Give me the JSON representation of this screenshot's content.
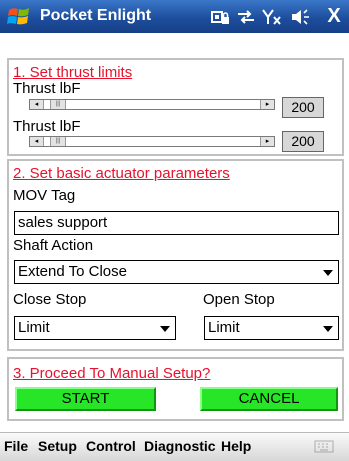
{
  "titlebar": {
    "app_title": "Pocket Enlight",
    "icons": [
      "windows-flag-logo",
      "device-lock-icon",
      "connectivity-icon",
      "no-signal-icon",
      "speaker-icon",
      "close-icon"
    ],
    "close_label": "X"
  },
  "section1": {
    "title": "1. Set thrust limits",
    "slider1": {
      "label": "Thrust lbF",
      "value": "200"
    },
    "slider2": {
      "label": "Thrust lbF",
      "value": "200"
    }
  },
  "section2": {
    "title": "2. Set basic actuator parameters",
    "mov_tag_label": "MOV Tag",
    "mov_tag_value": "sales support",
    "shaft_action_label": "Shaft Action",
    "shaft_action_value": "Extend To Close",
    "close_stop_label": "Close Stop",
    "close_stop_value": "Limit",
    "open_stop_label": "Open Stop",
    "open_stop_value": "Limit"
  },
  "section3": {
    "title": "3. Proceed To Manual Setup?",
    "start_label": "START",
    "cancel_label": "CANCEL"
  },
  "menubar": {
    "items": [
      "File",
      "Setup",
      "Control",
      "Diagnostic",
      "Help"
    ]
  },
  "colors": {
    "titlebar": "#1d4e9e",
    "section_title": "#e8122c",
    "button_green": "#27e627"
  }
}
